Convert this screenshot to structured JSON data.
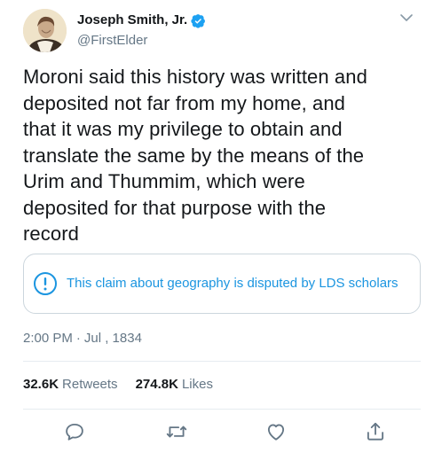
{
  "author": {
    "name": "Joseph Smith, Jr.",
    "handle": "@FirstElder",
    "verified": true
  },
  "tweet": {
    "text": "Moroni said this history was written and\ndeposited not far from my home, and\nthat it was my privilege to obtain and\ntranslate the same by the means of the\nUrim and Thummim, which were\ndeposited for that purpose with the\nrecord"
  },
  "notice": {
    "icon": "info-circle-icon",
    "text": "This claim about geography is disputed by LDS scholars"
  },
  "meta": {
    "time": "2:00 PM",
    "separator": "·",
    "date": "Jul , 1834"
  },
  "stats": {
    "retweets_count": "32.6K",
    "retweets_label": "Retweets",
    "likes_count": "274.8K",
    "likes_label": "Likes"
  },
  "actions": [
    "reply-icon",
    "retweet-icon",
    "like-icon",
    "share-icon"
  ],
  "colors": {
    "accent": "#1b95e0",
    "verified": "#1da1f2",
    "muted": "#657786",
    "border": "#ccd6dd"
  }
}
